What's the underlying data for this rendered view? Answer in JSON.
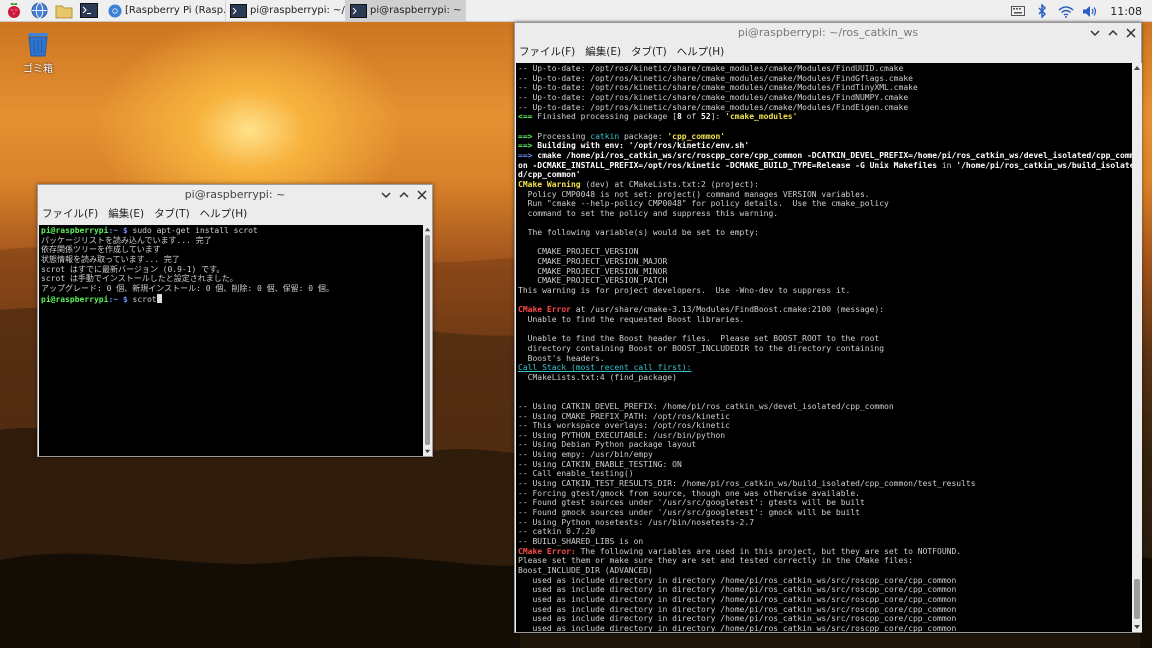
{
  "taskbar": {
    "tasks": [
      {
        "label": "[Raspberry Pi  (Rasp..."
      },
      {
        "label": "pi@raspberrypi: ~/ros..."
      },
      {
        "label": "pi@raspberrypi: ~"
      }
    ],
    "clock": "11:08"
  },
  "desktop": {
    "trash_label": "ゴミ箱"
  },
  "small_window": {
    "title": "pi@raspberrypi: ~",
    "menu": [
      "ファイル(F)",
      "編集(E)",
      "タブ(T)",
      "ヘルプ(H)"
    ],
    "prompt": "pi@raspberrypi",
    "prompt_path": ":~ $",
    "command1": " sudo apt-get install scrot",
    "output": [
      "パッケージリストを読み込んでいます... 完了",
      "依存関係ツリーを作成しています",
      "状態情報を読み取っています... 完了",
      "scrot はすでに最新バージョン (0.9-1) です。",
      "scrot は手動でインストールしたと設定されました。",
      "アップグレード: 0 個、新規インストール: 0 個、削除: 0 個、保留: 0 個。"
    ],
    "command2": " scrot"
  },
  "big_window": {
    "title": "pi@raspberrypi: ~/ros_catkin_ws",
    "menu": [
      "ファイル(F)",
      "編集(E)",
      "タブ(T)",
      "ヘルプ(H)"
    ],
    "lines": [
      {
        "parts": [
          [
            "",
            "-- Up-to-date: /opt/ros/kinetic/share/cmake_modules/cmake/Modules/FindUUID.cmake"
          ]
        ]
      },
      {
        "parts": [
          [
            "",
            "-- Up-to-date: /opt/ros/kinetic/share/cmake_modules/cmake/Modules/FindGflags.cmake"
          ]
        ]
      },
      {
        "parts": [
          [
            "",
            "-- Up-to-date: /opt/ros/kinetic/share/cmake_modules/cmake/Modules/FindTinyXML.cmake"
          ]
        ]
      },
      {
        "parts": [
          [
            "",
            "-- Up-to-date: /opt/ros/kinetic/share/cmake_modules/cmake/Modules/FindNUMPY.cmake"
          ]
        ]
      },
      {
        "parts": [
          [
            "",
            "-- Up-to-date: /opt/ros/kinetic/share/cmake_modules/cmake/Modules/FindEigen.cmake"
          ]
        ]
      },
      {
        "parts": [
          [
            "c-green",
            "<== "
          ],
          [
            "",
            "Finished processing package ["
          ],
          [
            "c-white-b",
            "8"
          ],
          [
            "",
            " of "
          ],
          [
            "c-white-b",
            "52"
          ],
          [
            "",
            "]: "
          ],
          [
            "c-yellow",
            "'cmake_modules'"
          ]
        ]
      },
      {
        "parts": [
          [
            "",
            ""
          ]
        ]
      },
      {
        "parts": [
          [
            "c-green",
            "==> "
          ],
          [
            "",
            "Processing "
          ],
          [
            "c-cyan",
            "catkin"
          ],
          [
            "",
            " package: "
          ],
          [
            "c-yellow",
            "'cpp_common'"
          ]
        ]
      },
      {
        "parts": [
          [
            "c-green",
            "==> "
          ],
          [
            "c-white-b",
            "Building with env: '/opt/ros/kinetic/env.sh'"
          ]
        ]
      },
      {
        "parts": [
          [
            "c-blue",
            "==> "
          ],
          [
            "c-white-b",
            "cmake /home/pi/ros_catkin_ws/src/roscpp_core/cpp_common -DCATKIN_DEVEL_PREFIX=/home/pi/ros_catkin_ws/devel_isolated/cpp_comm"
          ]
        ]
      },
      {
        "parts": [
          [
            "c-white-b",
            "on -DCMAKE_INSTALL_PREFIX=/opt/ros/kinetic -DCMAKE_BUILD_TYPE=Release -G Unix Makefiles"
          ],
          [
            "",
            " in "
          ],
          [
            "c-white-b",
            "'/home/pi/ros_catkin_ws/build_isolate"
          ]
        ]
      },
      {
        "parts": [
          [
            "c-white-b",
            "d/cpp_common'"
          ]
        ]
      },
      {
        "parts": [
          [
            "c-yellow",
            "CMake Warning"
          ],
          [
            "",
            " (dev) at CMakeLists.txt:2 (project):"
          ]
        ]
      },
      {
        "parts": [
          [
            "",
            "  Policy CMP0048 is not set: project() command manages VERSION variables."
          ]
        ]
      },
      {
        "parts": [
          [
            "",
            "  Run \"cmake --help-policy CMP0048\" for policy details.  Use the cmake_policy"
          ]
        ]
      },
      {
        "parts": [
          [
            "",
            "  command to set the policy and suppress this warning."
          ]
        ]
      },
      {
        "parts": [
          [
            "",
            ""
          ]
        ]
      },
      {
        "parts": [
          [
            "",
            "  The following variable(s) would be set to empty:"
          ]
        ]
      },
      {
        "parts": [
          [
            "",
            ""
          ]
        ]
      },
      {
        "parts": [
          [
            "",
            "    CMAKE_PROJECT_VERSION"
          ]
        ]
      },
      {
        "parts": [
          [
            "",
            "    CMAKE_PROJECT_VERSION_MAJOR"
          ]
        ]
      },
      {
        "parts": [
          [
            "",
            "    CMAKE_PROJECT_VERSION_MINOR"
          ]
        ]
      },
      {
        "parts": [
          [
            "",
            "    CMAKE_PROJECT_VERSION_PATCH"
          ]
        ]
      },
      {
        "parts": [
          [
            "",
            "This warning is for project developers.  Use -Wno-dev to suppress it."
          ]
        ]
      },
      {
        "parts": [
          [
            "",
            ""
          ]
        ]
      },
      {
        "parts": [
          [
            "c-red",
            "CMake Error"
          ],
          [
            "",
            " at /usr/share/cmake-3.13/Modules/FindBoost.cmake:2100 (message):"
          ]
        ]
      },
      {
        "parts": [
          [
            "",
            "  Unable to find the requested Boost libraries."
          ]
        ]
      },
      {
        "parts": [
          [
            "",
            ""
          ]
        ]
      },
      {
        "parts": [
          [
            "",
            "  Unable to find the Boost header files.  Please set BOOST_ROOT to the root"
          ]
        ]
      },
      {
        "parts": [
          [
            "",
            "  directory containing Boost or BOOST_INCLUDEDIR to the directory containing"
          ]
        ]
      },
      {
        "parts": [
          [
            "",
            "  Boost's headers."
          ]
        ]
      },
      {
        "parts": [
          [
            "c-link",
            "Call Stack (most recent call first):"
          ]
        ]
      },
      {
        "parts": [
          [
            "",
            "  CMakeLists.txt:4 (find_package)"
          ]
        ]
      },
      {
        "parts": [
          [
            "",
            ""
          ]
        ]
      },
      {
        "parts": [
          [
            "",
            ""
          ]
        ]
      },
      {
        "parts": [
          [
            "",
            "-- Using CATKIN_DEVEL_PREFIX: /home/pi/ros_catkin_ws/devel_isolated/cpp_common"
          ]
        ]
      },
      {
        "parts": [
          [
            "",
            "-- Using CMAKE_PREFIX_PATH: /opt/ros/kinetic"
          ]
        ]
      },
      {
        "parts": [
          [
            "",
            "-- This workspace overlays: /opt/ros/kinetic"
          ]
        ]
      },
      {
        "parts": [
          [
            "",
            "-- Using PYTHON_EXECUTABLE: /usr/bin/python"
          ]
        ]
      },
      {
        "parts": [
          [
            "",
            "-- Using Debian Python package layout"
          ]
        ]
      },
      {
        "parts": [
          [
            "",
            "-- Using empy: /usr/bin/empy"
          ]
        ]
      },
      {
        "parts": [
          [
            "",
            "-- Using CATKIN_ENABLE_TESTING: ON"
          ]
        ]
      },
      {
        "parts": [
          [
            "",
            "-- Call enable_testing()"
          ]
        ]
      },
      {
        "parts": [
          [
            "",
            "-- Using CATKIN_TEST_RESULTS_DIR: /home/pi/ros_catkin_ws/build_isolated/cpp_common/test_results"
          ]
        ]
      },
      {
        "parts": [
          [
            "",
            "-- Forcing gtest/gmock from source, though one was otherwise available."
          ]
        ]
      },
      {
        "parts": [
          [
            "",
            "-- Found gtest sources under '/usr/src/googletest': gtests will be built"
          ]
        ]
      },
      {
        "parts": [
          [
            "",
            "-- Found gmock sources under '/usr/src/googletest': gmock will be built"
          ]
        ]
      },
      {
        "parts": [
          [
            "",
            "-- Using Python nosetests: /usr/bin/nosetests-2.7"
          ]
        ]
      },
      {
        "parts": [
          [
            "",
            "-- catkin 0.7.20"
          ]
        ]
      },
      {
        "parts": [
          [
            "",
            "-- BUILD_SHARED_LIBS is on"
          ]
        ]
      },
      {
        "parts": [
          [
            "c-red",
            "CMake Error:"
          ],
          [
            "",
            " The following variables are used in this project, but they are set to NOTFOUND."
          ]
        ]
      },
      {
        "parts": [
          [
            "",
            "Please set them or make sure they are set and tested correctly in the CMake files:"
          ]
        ]
      },
      {
        "parts": [
          [
            "",
            "Boost_INCLUDE_DIR (ADVANCED)"
          ]
        ]
      },
      {
        "parts": [
          [
            "",
            "   used as include directory in directory /home/pi/ros_catkin_ws/src/roscpp_core/cpp_common"
          ]
        ]
      },
      {
        "parts": [
          [
            "",
            "   used as include directory in directory /home/pi/ros_catkin_ws/src/roscpp_core/cpp_common"
          ]
        ]
      },
      {
        "parts": [
          [
            "",
            "   used as include directory in directory /home/pi/ros_catkin_ws/src/roscpp_core/cpp_common"
          ]
        ]
      },
      {
        "parts": [
          [
            "",
            "   used as include directory in directory /home/pi/ros_catkin_ws/src/roscpp_core/cpp_common"
          ]
        ]
      },
      {
        "parts": [
          [
            "",
            "   used as include directory in directory /home/pi/ros_catkin_ws/src/roscpp_core/cpp_common"
          ]
        ]
      },
      {
        "parts": [
          [
            "",
            "   used as include directory in directory /home/pi/ros_catkin_ws/src/roscpp_core/cpp_common"
          ]
        ]
      }
    ]
  },
  "colors": {
    "prompt_user": "#5ff05f",
    "prompt_path": "#6f8cff",
    "warning": "#f0e24f",
    "error": "#ff4a4a"
  }
}
